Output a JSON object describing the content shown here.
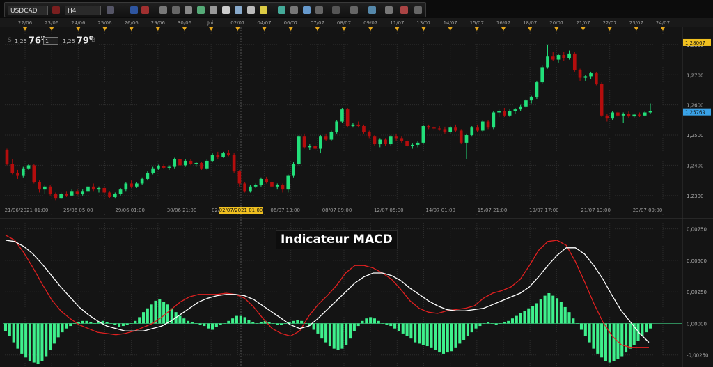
{
  "toolbar": {
    "symbol": "USDCAD",
    "timeframe": "H4"
  },
  "quote": {
    "sell_prefix": "1,25",
    "sell_pips": "76",
    "sell_sup": "9",
    "lot": "1",
    "buy_prefix": "1,25",
    "buy_pips": "79",
    "buy_sup": "0",
    "sell_letter": "S",
    "buy_letter": "B"
  },
  "macd_title": "Indicateur MACD",
  "colors": {
    "up": "#22e07a",
    "down": "#b40d0d",
    "signal": "#ffffff",
    "macd": "#e02020",
    "hist": "#3ef08c",
    "bg": "#141414"
  },
  "chart_data": [
    {
      "type": "candlestick",
      "symbol": "USDCAD",
      "timeframe": "H4",
      "x_top_labels": [
        "22/06",
        "23/06",
        "24/06",
        "25/06",
        "26/06",
        "29/06",
        "30/06",
        "Juil",
        "02/07",
        "04/07",
        "06/07",
        "07/07",
        "08/07",
        "09/07",
        "11/07",
        "13/07",
        "14/07",
        "15/07",
        "16/07",
        "18/07",
        "20/07",
        "21/07",
        "22/07",
        "23/07",
        "24/07"
      ],
      "x_bottom_labels": [
        "21/06/2021 01:00",
        "25/06 05:00",
        "29/06 01:00",
        "30/06 21:00",
        "02/07/2021 01:00",
        "06/07 13:00",
        "08/07 09:00",
        "12/07 05:00",
        "14/07 01:00",
        "15/07 21:00",
        "19/07 17:00",
        "21/07 13:00",
        "23/07 09:00"
      ],
      "crosshair_label": "02/07/2021 01:00",
      "y_ticks": [
        "1,2800",
        "1,2700",
        "1,2600",
        "1,2500",
        "1,2400",
        "1,2300"
      ],
      "y_ticks_values": [
        1.28,
        1.27,
        1.26,
        1.25,
        1.24,
        1.23
      ],
      "ylim": [
        1.2265,
        1.2855
      ],
      "price_tags": [
        {
          "label": "1,28067",
          "value": 1.28067,
          "color": "#f0c020"
        },
        {
          "label": "1,25769",
          "value": 1.25769,
          "color": "#3aa3e8"
        }
      ],
      "candles": [
        [
          1.245,
          1.2455,
          1.24,
          1.2405
        ],
        [
          1.2405,
          1.242,
          1.237,
          1.2375
        ],
        [
          1.2375,
          1.2385,
          1.2355,
          1.2365
        ],
        [
          1.2365,
          1.2395,
          1.236,
          1.239
        ],
        [
          1.239,
          1.2405,
          1.2385,
          1.24
        ],
        [
          1.24,
          1.2405,
          1.234,
          1.2345
        ],
        [
          1.2345,
          1.235,
          1.231,
          1.232
        ],
        [
          1.232,
          1.2335,
          1.2305,
          1.233
        ],
        [
          1.233,
          1.2335,
          1.23,
          1.2305
        ],
        [
          1.2305,
          1.231,
          1.2285,
          1.229
        ],
        [
          1.229,
          1.231,
          1.2288,
          1.2305
        ],
        [
          1.2305,
          1.2315,
          1.2295,
          1.23
        ],
        [
          1.23,
          1.232,
          1.2298,
          1.2315
        ],
        [
          1.2315,
          1.2322,
          1.23,
          1.2305
        ],
        [
          1.2305,
          1.232,
          1.23,
          1.2315
        ],
        [
          1.2315,
          1.2335,
          1.2312,
          1.233
        ],
        [
          1.233,
          1.234,
          1.2315,
          1.232
        ],
        [
          1.232,
          1.233,
          1.231,
          1.2325
        ],
        [
          1.2325,
          1.233,
          1.2305,
          1.231
        ],
        [
          1.231,
          1.2315,
          1.2292,
          1.2295
        ],
        [
          1.2295,
          1.231,
          1.229,
          1.2305
        ],
        [
          1.2305,
          1.2325,
          1.23,
          1.232
        ],
        [
          1.232,
          1.2345,
          1.2315,
          1.234
        ],
        [
          1.234,
          1.235,
          1.2325,
          1.233
        ],
        [
          1.233,
          1.2345,
          1.2325,
          1.234
        ],
        [
          1.234,
          1.236,
          1.2335,
          1.2355
        ],
        [
          1.2355,
          1.238,
          1.235,
          1.2375
        ],
        [
          1.2375,
          1.2395,
          1.237,
          1.239
        ],
        [
          1.239,
          1.2402,
          1.2385,
          1.2398
        ],
        [
          1.2398,
          1.2405,
          1.2388,
          1.2392
        ],
        [
          1.2392,
          1.24,
          1.2385,
          1.2395
        ],
        [
          1.2395,
          1.2425,
          1.239,
          1.242
        ],
        [
          1.242,
          1.243,
          1.2395,
          1.24
        ],
        [
          1.24,
          1.242,
          1.2395,
          1.2415
        ],
        [
          1.2415,
          1.242,
          1.24,
          1.2405
        ],
        [
          1.2405,
          1.241,
          1.2395,
          1.2408
        ],
        [
          1.2408,
          1.2412,
          1.2385,
          1.239
        ],
        [
          1.239,
          1.242,
          1.2385,
          1.2415
        ],
        [
          1.2415,
          1.244,
          1.241,
          1.2435
        ],
        [
          1.2435,
          1.2445,
          1.242,
          1.2428
        ],
        [
          1.2428,
          1.2445,
          1.2425,
          1.244
        ],
        [
          1.244,
          1.245,
          1.243,
          1.2435
        ],
        [
          1.2435,
          1.244,
          1.2375,
          1.238
        ],
        [
          1.238,
          1.2385,
          1.233,
          1.234
        ],
        [
          1.234,
          1.2345,
          1.231,
          1.2315
        ],
        [
          1.2315,
          1.2335,
          1.231,
          1.233
        ],
        [
          1.233,
          1.234,
          1.2325,
          1.2335
        ],
        [
          1.2335,
          1.236,
          1.233,
          1.2355
        ],
        [
          1.2355,
          1.2362,
          1.234,
          1.2345
        ],
        [
          1.2345,
          1.235,
          1.2325,
          1.233
        ],
        [
          1.233,
          1.234,
          1.232,
          1.2335
        ],
        [
          1.2335,
          1.234,
          1.231,
          1.232
        ],
        [
          1.232,
          1.237,
          1.231,
          1.2365
        ],
        [
          1.2365,
          1.241,
          1.236,
          1.2405
        ],
        [
          1.2405,
          1.25,
          1.24,
          1.2495
        ],
        [
          1.2495,
          1.2505,
          1.2455,
          1.246
        ],
        [
          1.246,
          1.247,
          1.245,
          1.2465
        ],
        [
          1.2465,
          1.2475,
          1.245,
          1.2455
        ],
        [
          1.2455,
          1.25,
          1.244,
          1.2495
        ],
        [
          1.2495,
          1.2505,
          1.248,
          1.2485
        ],
        [
          1.2485,
          1.2515,
          1.248,
          1.251
        ],
        [
          1.251,
          1.255,
          1.2505,
          1.2545
        ],
        [
          1.2545,
          1.259,
          1.254,
          1.2585
        ],
        [
          1.2585,
          1.259,
          1.2525,
          1.253
        ],
        [
          1.253,
          1.254,
          1.2525,
          1.2535
        ],
        [
          1.2535,
          1.2545,
          1.2525,
          1.253
        ],
        [
          1.253,
          1.2535,
          1.2505,
          1.251
        ],
        [
          1.251,
          1.2515,
          1.249,
          1.2495
        ],
        [
          1.2495,
          1.25,
          1.2465,
          1.247
        ],
        [
          1.247,
          1.249,
          1.246,
          1.2485
        ],
        [
          1.2485,
          1.249,
          1.2465,
          1.247
        ],
        [
          1.247,
          1.25,
          1.2465,
          1.2495
        ],
        [
          1.2495,
          1.2505,
          1.248,
          1.249
        ],
        [
          1.249,
          1.2495,
          1.2475,
          1.248
        ],
        [
          1.248,
          1.2485,
          1.246,
          1.2465
        ],
        [
          1.2465,
          1.2472,
          1.2455,
          1.2468
        ],
        [
          1.2468,
          1.248,
          1.246,
          1.2475
        ],
        [
          1.2475,
          1.2535,
          1.247,
          1.253
        ],
        [
          1.253,
          1.2535,
          1.252,
          1.2525
        ],
        [
          1.2525,
          1.253,
          1.2515,
          1.2522
        ],
        [
          1.2522,
          1.253,
          1.2515,
          1.252
        ],
        [
          1.252,
          1.2528,
          1.2505,
          1.251
        ],
        [
          1.251,
          1.253,
          1.2505,
          1.2525
        ],
        [
          1.2525,
          1.2535,
          1.251,
          1.2515
        ],
        [
          1.2515,
          1.252,
          1.247,
          1.2475
        ],
        [
          1.2475,
          1.2505,
          1.242,
          1.25
        ],
        [
          1.25,
          1.253,
          1.2495,
          1.2525
        ],
        [
          1.2525,
          1.2535,
          1.251,
          1.2515
        ],
        [
          1.2515,
          1.255,
          1.251,
          1.2545
        ],
        [
          1.2545,
          1.255,
          1.252,
          1.2525
        ],
        [
          1.2525,
          1.258,
          1.252,
          1.2575
        ],
        [
          1.2575,
          1.2585,
          1.256,
          1.258
        ],
        [
          1.258,
          1.259,
          1.256,
          1.2565
        ],
        [
          1.2565,
          1.2585,
          1.256,
          1.258
        ],
        [
          1.258,
          1.259,
          1.257,
          1.2585
        ],
        [
          1.2585,
          1.26,
          1.258,
          1.2595
        ],
        [
          1.2595,
          1.262,
          1.259,
          1.2615
        ],
        [
          1.2615,
          1.263,
          1.2605,
          1.2625
        ],
        [
          1.2625,
          1.268,
          1.262,
          1.2675
        ],
        [
          1.2675,
          1.273,
          1.267,
          1.2725
        ],
        [
          1.2725,
          1.28,
          1.272,
          1.276
        ],
        [
          1.276,
          1.2775,
          1.2745,
          1.275
        ],
        [
          1.275,
          1.277,
          1.274,
          1.2765
        ],
        [
          1.2765,
          1.2775,
          1.2745,
          1.2755
        ],
        [
          1.2755,
          1.278,
          1.275,
          1.277
        ],
        [
          1.277,
          1.2775,
          1.271,
          1.2715
        ],
        [
          1.2715,
          1.272,
          1.268,
          1.269
        ],
        [
          1.269,
          1.27,
          1.268,
          1.2695
        ],
        [
          1.2695,
          1.271,
          1.2685,
          1.2705
        ],
        [
          1.2705,
          1.271,
          1.2665,
          1.267
        ],
        [
          1.267,
          1.2675,
          1.256,
          1.2565
        ],
        [
          1.2565,
          1.257,
          1.2545,
          1.2555
        ],
        [
          1.2555,
          1.258,
          1.255,
          1.2575
        ],
        [
          1.2575,
          1.258,
          1.256,
          1.2565
        ],
        [
          1.2565,
          1.2575,
          1.254,
          1.257
        ],
        [
          1.257,
          1.2578,
          1.2558,
          1.2562
        ],
        [
          1.2562,
          1.2572,
          1.2558,
          1.2568
        ],
        [
          1.2568,
          1.2575,
          1.256,
          1.2565
        ],
        [
          1.2565,
          1.258,
          1.2562,
          1.2575
        ],
        [
          1.2575,
          1.2605,
          1.257,
          1.258
        ]
      ]
    },
    {
      "type": "macd",
      "title": "Indicateur MACD",
      "y_ticks": [
        "0,00750",
        "0,00500",
        "0,00250",
        "0,00000",
        "-0,00250"
      ],
      "y_ticks_values": [
        0.0075,
        0.005,
        0.0025,
        0.0,
        -0.0025
      ],
      "ylim": [
        -0.0034,
        0.0082
      ],
      "series": [
        {
          "values": [
            0.007,
            0.0066,
            0.0056,
            0.0044,
            0.0031,
            0.0019,
            0.001,
            0.0004,
            -0.0001,
            -0.0004,
            -0.0007,
            -0.0008,
            -0.0009,
            -0.0008,
            -0.0006,
            -0.0003,
            0.0,
            0.0005,
            0.0011,
            0.0017,
            0.0021,
            0.0023,
            0.0023,
            0.0023,
            0.0024,
            0.0023,
            0.002,
            0.0013,
            0.0004,
            -0.0004,
            -0.0008,
            -0.001,
            -0.0006,
            0.0006,
            0.0015,
            0.0022,
            0.003,
            0.004,
            0.0046,
            0.0046,
            0.0044,
            0.004,
            0.0035,
            0.0027,
            0.0018,
            0.0012,
            0.0009,
            0.0008,
            0.001,
            0.0011,
            0.0012,
            0.0014,
            0.002,
            0.0024,
            0.0026,
            0.0029,
            0.0035,
            0.0046,
            0.0058,
            0.0065,
            0.0066,
            0.0062,
            0.0049,
            0.0033,
            0.0016,
            0.0001,
            -0.001,
            -0.0017,
            -0.0019,
            -0.0019,
            -0.0019
          ]
        },
        {
          "values": [
            0.0066,
            0.0065,
            0.0061,
            0.0055,
            0.0047,
            0.0038,
            0.0029,
            0.0021,
            0.0013,
            0.0007,
            0.0002,
            -0.0002,
            -0.0004,
            -0.0006,
            -0.0006,
            -0.0006,
            -0.0004,
            -0.0002,
            0.0002,
            0.0007,
            0.0012,
            0.0017,
            0.002,
            0.0022,
            0.0023,
            0.0023,
            0.0022,
            0.0019,
            0.0014,
            0.0009,
            0.0004,
            -0.0001,
            -0.0004,
            -0.0002,
            0.0004,
            0.0011,
            0.0018,
            0.0025,
            0.0032,
            0.0037,
            0.004,
            0.004,
            0.0038,
            0.0034,
            0.0028,
            0.0023,
            0.0018,
            0.0014,
            0.0011,
            0.001,
            0.001,
            0.0011,
            0.0012,
            0.0015,
            0.0018,
            0.0021,
            0.0024,
            0.0029,
            0.0037,
            0.0046,
            0.0054,
            0.006,
            0.006,
            0.0055,
            0.0046,
            0.0035,
            0.0022,
            0.001,
            0.0001,
            -0.0008,
            -0.0015
          ]
        }
      ],
      "histogram": [
        -0.0006,
        -0.001,
        -0.0015,
        -0.002,
        -0.0024,
        -0.0027,
        -0.003,
        -0.0031,
        -0.0032,
        -0.003,
        -0.0026,
        -0.0021,
        -0.0016,
        -0.0011,
        -0.0007,
        -0.0004,
        -0.0002,
        0.0,
        0.0001,
        0.0002,
        0.0002,
        0.0001,
        0.0,
        0.0001,
        0.0002,
        0.0001,
        0.0,
        -0.0001,
        -0.0003,
        -0.0002,
        -0.0001,
        0.0,
        0.0002,
        0.0005,
        0.0009,
        0.0012,
        0.0015,
        0.0018,
        0.0019,
        0.0017,
        0.0015,
        0.0012,
        0.0009,
        0.0006,
        0.0004,
        0.0002,
        0.0001,
        0.0,
        -0.0001,
        -0.0002,
        -0.0004,
        -0.0005,
        -0.0003,
        -0.0001,
        0.0,
        0.0002,
        0.0004,
        0.0006,
        0.0006,
        0.0005,
        0.0003,
        0.0001,
        0.0,
        0.0001,
        0.0002,
        0.0001,
        0.0,
        -0.0001,
        -0.0001,
        0.0,
        0.0001,
        0.0002,
        0.0003,
        0.0002,
        0.0,
        -0.0002,
        -0.0005,
        -0.0008,
        -0.0012,
        -0.0015,
        -0.0018,
        -0.002,
        -0.0021,
        -0.002,
        -0.0017,
        -0.0012,
        -0.0006,
        -0.0002,
        0.0002,
        0.0004,
        0.0005,
        0.0004,
        0.0002,
        0.0,
        -0.0001,
        -0.0002,
        -0.0004,
        -0.0006,
        -0.0008,
        -0.001,
        -0.0012,
        -0.0015,
        -0.0016,
        -0.0017,
        -0.0018,
        -0.0019,
        -0.0021,
        -0.0023,
        -0.0024,
        -0.0023,
        -0.0022,
        -0.0019,
        -0.0016,
        -0.0013,
        -0.001,
        -0.0007,
        -0.0004,
        -0.0002,
        0.0,
        0.0001,
        0.0,
        -0.0001,
        0.0,
        0.0001,
        0.0002,
        0.0004,
        0.0006,
        0.0008,
        0.001,
        0.0012,
        0.0014,
        0.0016,
        0.0019,
        0.0022,
        0.0024,
        0.0022,
        0.002,
        0.0017,
        0.0013,
        0.0009,
        0.0004,
        0.0,
        -0.0005,
        -0.001,
        -0.0015,
        -0.002,
        -0.0024,
        -0.0027,
        -0.003,
        -0.0031,
        -0.003,
        -0.0028,
        -0.0026,
        -0.0023,
        -0.002,
        -0.0017,
        -0.0014,
        -0.001,
        -0.0007,
        -0.0004
      ]
    }
  ]
}
